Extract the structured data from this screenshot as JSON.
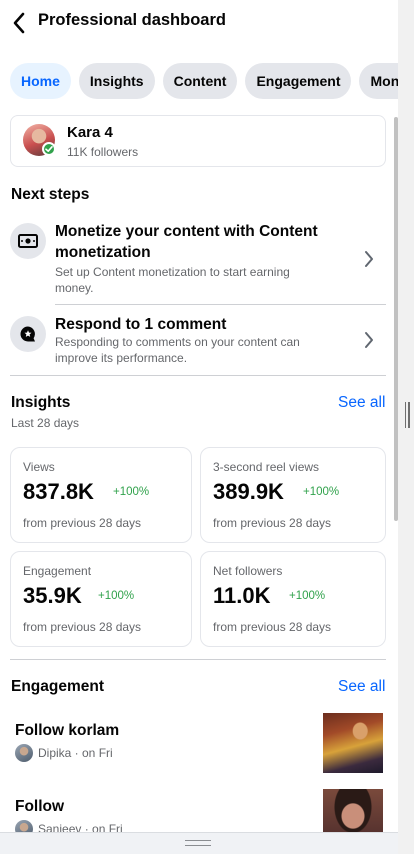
{
  "header": {
    "title": "Professional dashboard"
  },
  "tabs": [
    {
      "label": "Home",
      "active": true
    },
    {
      "label": "Insights",
      "active": false
    },
    {
      "label": "Content",
      "active": false
    },
    {
      "label": "Engagement",
      "active": false
    },
    {
      "label": "Monetization",
      "active": false
    }
  ],
  "profile": {
    "name": "Kara 4",
    "followers": "11K followers"
  },
  "next_steps": {
    "title": "Next steps",
    "items": [
      {
        "title": "Monetize your content with Content monetization",
        "description": "Set up Content monetization to start earning money.",
        "icon": "money-icon"
      },
      {
        "title": "Respond to 1 comment",
        "description": "Responding to comments on your content can improve its performance.",
        "icon": "comment-star-icon"
      }
    ]
  },
  "insights": {
    "title": "Insights",
    "see_all": "See all",
    "period": "Last 28 days",
    "metrics": [
      {
        "label": "Views",
        "value": "837.8K",
        "change": "+100%",
        "footer": "from previous 28 days"
      },
      {
        "label": "3-second reel views",
        "value": "389.9K",
        "change": "+100%",
        "footer": "from previous 28 days"
      },
      {
        "label": "Engagement",
        "value": "35.9K",
        "change": "+100%",
        "footer": "from previous 28 days"
      },
      {
        "label": "Net followers",
        "value": "11.0K",
        "change": "+100%",
        "footer": "from previous 28 days"
      }
    ]
  },
  "engagement": {
    "title": "Engagement",
    "see_all": "See all",
    "items": [
      {
        "title": "Follow korlam",
        "meta": "Dipika · on Fri"
      },
      {
        "title": "Follow",
        "meta": "Sanjeev · on Fri"
      }
    ]
  },
  "colors": {
    "accent": "#0866ff",
    "positive": "#31a24c",
    "secondary_text": "#65676b"
  }
}
